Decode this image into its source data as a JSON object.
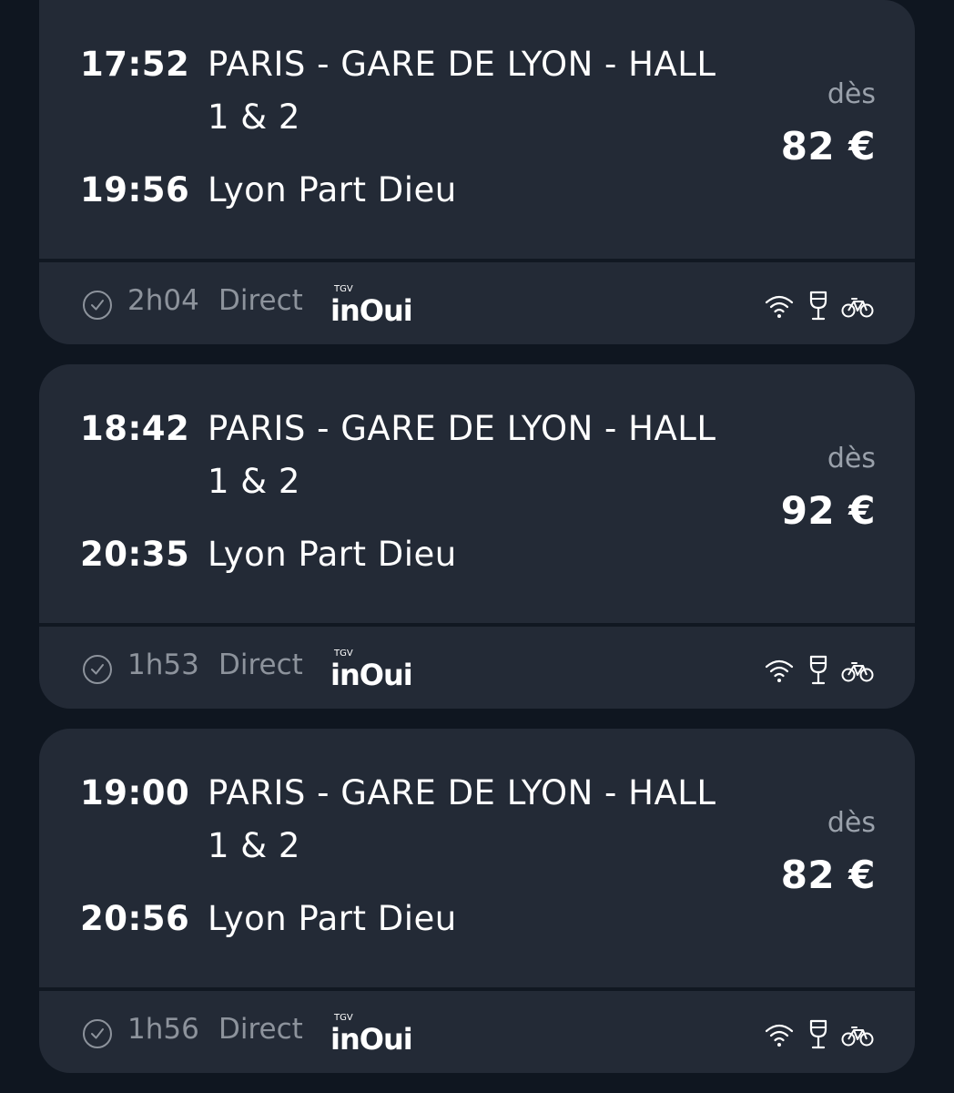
{
  "price_prefix": "dès",
  "trains": [
    {
      "departure_time": "17:52",
      "departure_station_line1": "PARIS - GARE DE LYON - HALL",
      "departure_station_line2": "1 & 2",
      "arrival_time": "19:56",
      "arrival_station": "Lyon Part Dieu",
      "price": "82 €",
      "duration": "2h04",
      "connection": "Direct",
      "operator_logo": "TGV inOui",
      "amenities": [
        "wifi-icon",
        "bar-wine-glass-icon",
        "bicycle-icon"
      ]
    },
    {
      "departure_time": "18:42",
      "departure_station_line1": "PARIS - GARE DE LYON - HALL",
      "departure_station_line2": "1 & 2",
      "arrival_time": "20:35",
      "arrival_station": "Lyon Part Dieu",
      "price": "92 €",
      "duration": "1h53",
      "connection": "Direct",
      "operator_logo": "TGV inOui",
      "amenities": [
        "wifi-icon",
        "bar-wine-glass-icon",
        "bicycle-icon"
      ]
    },
    {
      "departure_time": "19:00",
      "departure_station_line1": "PARIS - GARE DE LYON - HALL",
      "departure_station_line2": "1 & 2",
      "arrival_time": "20:56",
      "arrival_station": "Lyon Part Dieu",
      "price": "82 €",
      "duration": "1h56",
      "connection": "Direct",
      "operator_logo": "TGV inOui",
      "amenities": [
        "wifi-icon",
        "bar-wine-glass-icon",
        "bicycle-icon"
      ]
    }
  ],
  "colors": {
    "background": "#0f1620",
    "card": "#232a36",
    "text_primary": "#ffffff",
    "text_secondary": "#8d939c"
  }
}
